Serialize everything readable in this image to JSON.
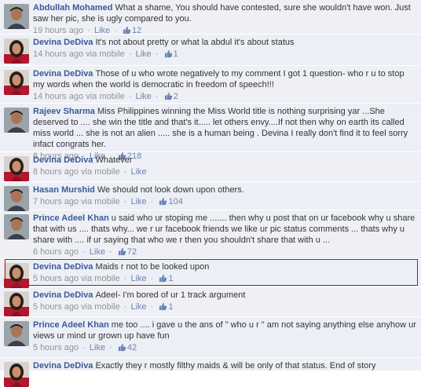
{
  "comments": [
    {
      "author": "Abdullah Mohamed",
      "text": "What a shame, You should have contested, sure she wouldn't have won. Just saw her pic, she is ugly compared to you.",
      "time": "19 hours ago",
      "via": "",
      "like": "Like",
      "likes": "12"
    },
    {
      "author": "Devina DeDiva",
      "text": "It's not about pretty or what la abdul it's about status",
      "time": "14 hours ago",
      "via": "via mobile",
      "like": "Like",
      "likes": "1"
    },
    {
      "author": "Devina DeDiva",
      "text": "Those of u who wrote negatively to my comment I got 1 question- who r u to stop my words when the world is democratic in freedom of speech!!!",
      "time": "14 hours ago",
      "via": "via mobile",
      "like": "Like",
      "likes": "2"
    },
    {
      "author": "Rajeev Sharma",
      "text": "Miss Philippines winning the Miss World title is nothing surprising yar ...She deserved to .... she win the title and that's it..... let others envy....If not then why on earth its called miss world ... she is not an alien ..... she is a human being . Devina I really don't find it to feel sorry infact congrats her.",
      "time": "8 hours ago",
      "via": "",
      "like": "Like",
      "likes": "218"
    },
    {
      "author": "Devina DeDiva",
      "text": "Whatever",
      "time": "8 hours ago",
      "via": "via mobile",
      "like": "Like",
      "likes": ""
    },
    {
      "author": "Hasan Murshid",
      "text": "We should not look down upon others.",
      "time": "7 hours ago",
      "via": "via mobile",
      "like": "Like",
      "likes": "104"
    },
    {
      "author": "Prince Adeel Khan",
      "text": "u said who ur stoping me ....... then why u post that on ur facebook why u share that with us .... thats why... we r ur facebook friends we like ur pic status comments ... thats why u share with .... if ur saying that who we r then you shouldn't share that with u ...",
      "time": "6 hours ago",
      "via": "",
      "like": "Like",
      "likes": "72"
    },
    {
      "author": "Devina DeDiva",
      "text": "Maids r not to be looked upon",
      "time": "5 hours ago",
      "via": "via mobile",
      "like": "Like",
      "likes": "1"
    },
    {
      "author": "Devina DeDiva",
      "text": "Adeel- I'm bored of ur 1 track argument",
      "time": "5 hours ago",
      "via": "via mobile",
      "like": "Like",
      "likes": "1"
    },
    {
      "author": "Prince Adeel Khan",
      "text": "me too .... i gave u the ans of \" who u r \" am not saying anything else anyhow ur views ur mind ur grown up have fun",
      "time": "5 hours ago",
      "via": "",
      "like": "Like",
      "likes": "42"
    },
    {
      "author": "Devina DeDiva",
      "text": "Exactly they r mostly filthy maids & will be only of that status. End of story",
      "time": "",
      "via": "",
      "like": "",
      "likes": ""
    }
  ],
  "avatars": [
    "man-avatar",
    "woman-avatar",
    "woman-avatar",
    "man-avatar",
    "woman-avatar",
    "man-avatar",
    "man-avatar",
    "woman-avatar",
    "woman-avatar",
    "man-avatar",
    "woman-avatar"
  ],
  "colors": {
    "author": "#3b5998",
    "link": "#6d84b4",
    "meta": "#8f949a",
    "background": "#eef0f5",
    "highlight": "#c0141a"
  }
}
